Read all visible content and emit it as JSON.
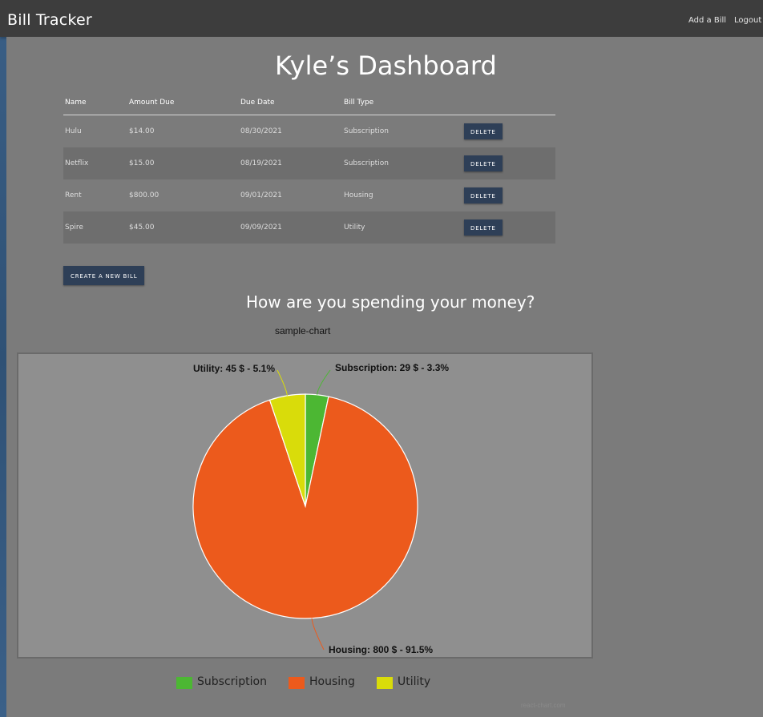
{
  "navbar": {
    "brand": "Bill Tracker",
    "links": [
      "Add a Bill",
      "Logout"
    ]
  },
  "dashboard_title": "Kyle’s Dashboard",
  "table": {
    "headers": [
      "Name",
      "Amount Due",
      "Due Date",
      "Bill Type"
    ],
    "rows": [
      {
        "name": "Hulu",
        "amount": "$14.00",
        "due": "08/30/2021",
        "type": "Subscription",
        "action": "DELETE"
      },
      {
        "name": "Netflix",
        "amount": "$15.00",
        "due": "08/19/2021",
        "type": "Subscription",
        "action": "DELETE"
      },
      {
        "name": "Rent",
        "amount": "$800.00",
        "due": "09/01/2021",
        "type": "Housing",
        "action": "DELETE"
      },
      {
        "name": "Spire",
        "amount": "$45.00",
        "due": "09/09/2021",
        "type": "Utility",
        "action": "DELETE"
      }
    ]
  },
  "create_button": "CREATE A NEW BILL",
  "spending_heading": "How are you spending your money?",
  "chart_data": {
    "type": "pie",
    "title": "sample-chart",
    "slices": [
      {
        "name": "Subscription",
        "value": 29,
        "label": "Subscription: 29 $ - 3.3%",
        "color": "#4cb733"
      },
      {
        "name": "Housing",
        "value": 800,
        "label": "Housing: 800 $ - 91.5%",
        "color": "#ec5a1c"
      },
      {
        "name": "Utility",
        "value": 45,
        "label": "Utility: 45 $ - 5.1%",
        "color": "#d9dc0a"
      }
    ],
    "legend": [
      "Subscription",
      "Housing",
      "Utility"
    ],
    "legend_position": "bottom"
  },
  "watermark": "react-chart.com"
}
